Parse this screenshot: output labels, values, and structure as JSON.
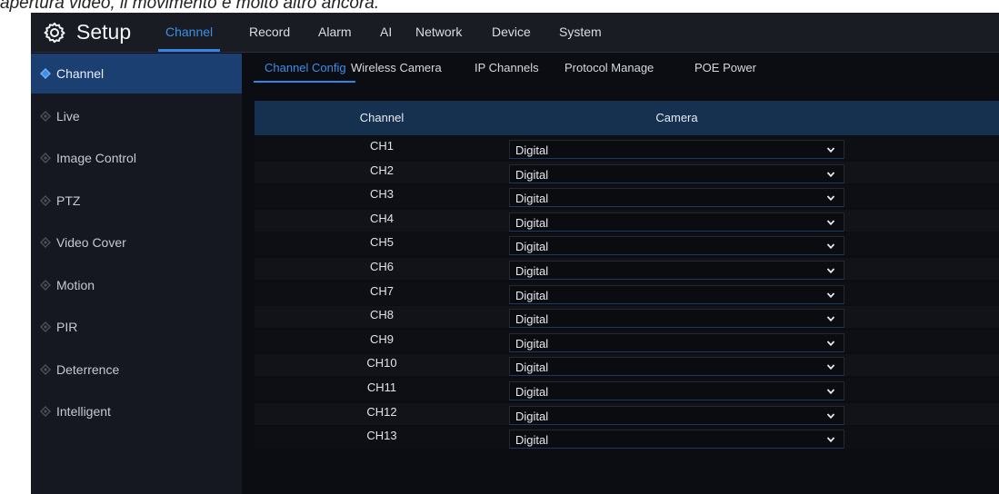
{
  "caption": "apertura video, il movimento è molto altro ancora.",
  "header": {
    "title": "Setup",
    "tabs": [
      "Channel",
      "Record",
      "Alarm",
      "AI",
      "Network",
      "Device",
      "System"
    ],
    "active_tab": "Channel"
  },
  "sidebar": {
    "items": [
      {
        "label": "Channel"
      },
      {
        "label": "Live"
      },
      {
        "label": "Image Control"
      },
      {
        "label": "PTZ"
      },
      {
        "label": "Video Cover"
      },
      {
        "label": "Motion"
      },
      {
        "label": "PIR"
      },
      {
        "label": "Deterrence"
      },
      {
        "label": "Intelligent"
      }
    ],
    "active": "Channel"
  },
  "subtabs": {
    "items": [
      "Channel Config",
      "Wireless Camera",
      "IP Channels",
      "Protocol Manage",
      "POE Power"
    ],
    "active": "Channel Config"
  },
  "table": {
    "headers": [
      "Channel",
      "Camera"
    ],
    "rows": [
      {
        "channel": "CH1",
        "camera": "Digital"
      },
      {
        "channel": "CH2",
        "camera": "Digital"
      },
      {
        "channel": "CH3",
        "camera": "Digital"
      },
      {
        "channel": "CH4",
        "camera": "Digital"
      },
      {
        "channel": "CH5",
        "camera": "Digital"
      },
      {
        "channel": "CH6",
        "camera": "Digital"
      },
      {
        "channel": "CH7",
        "camera": "Digital"
      },
      {
        "channel": "CH8",
        "camera": "Digital"
      },
      {
        "channel": "CH9",
        "camera": "Digital"
      },
      {
        "channel": "CH10",
        "camera": "Digital"
      },
      {
        "channel": "CH11",
        "camera": "Digital"
      },
      {
        "channel": "CH12",
        "camera": "Digital"
      },
      {
        "channel": "CH13",
        "camera": "Digital"
      }
    ]
  },
  "colors": {
    "accent": "#2f86e8",
    "active_sidebar": "#1b3f70",
    "table_header": "#16304f",
    "background": "#0b0d12"
  },
  "icons": {
    "brand": "gear-icon",
    "sidebar_bullet": "diamond-bullet-icon",
    "select": "chevron-down-icon"
  }
}
